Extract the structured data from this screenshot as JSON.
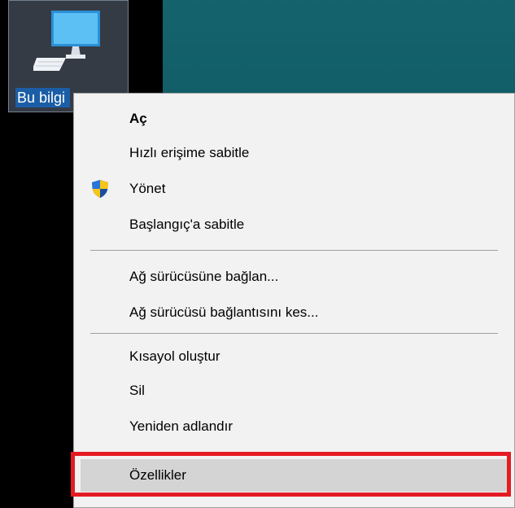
{
  "desktop": {
    "icon_label": "Bu bilgi",
    "colors": {
      "background_left": "#000000",
      "background_right": "#0f5863",
      "label_selection": "#1b5ea6"
    }
  },
  "context_menu": {
    "items": [
      {
        "label": "Aç",
        "bold": true,
        "icon": null
      },
      {
        "label": "Hızlı erişime sabitle",
        "icon": null
      },
      {
        "label": "Yönet",
        "icon": "uac-shield-icon"
      },
      {
        "label": "Başlangıç'a sabitle",
        "icon": null
      },
      {
        "label": "Ağ sürücüsüne bağlan...",
        "icon": null
      },
      {
        "label": "Ağ sürücüsü bağlantısını kes...",
        "icon": null
      },
      {
        "label": "Kısayol oluştur",
        "icon": null
      },
      {
        "label": "Sil",
        "icon": null
      },
      {
        "label": "Yeniden adlandır",
        "icon": null
      },
      {
        "label": "Özellikler",
        "icon": null,
        "highlighted": true
      }
    ],
    "colors": {
      "background": "#f2f2f2",
      "hover": "#d4d4d4",
      "annotation_border": "#e51b23"
    }
  }
}
